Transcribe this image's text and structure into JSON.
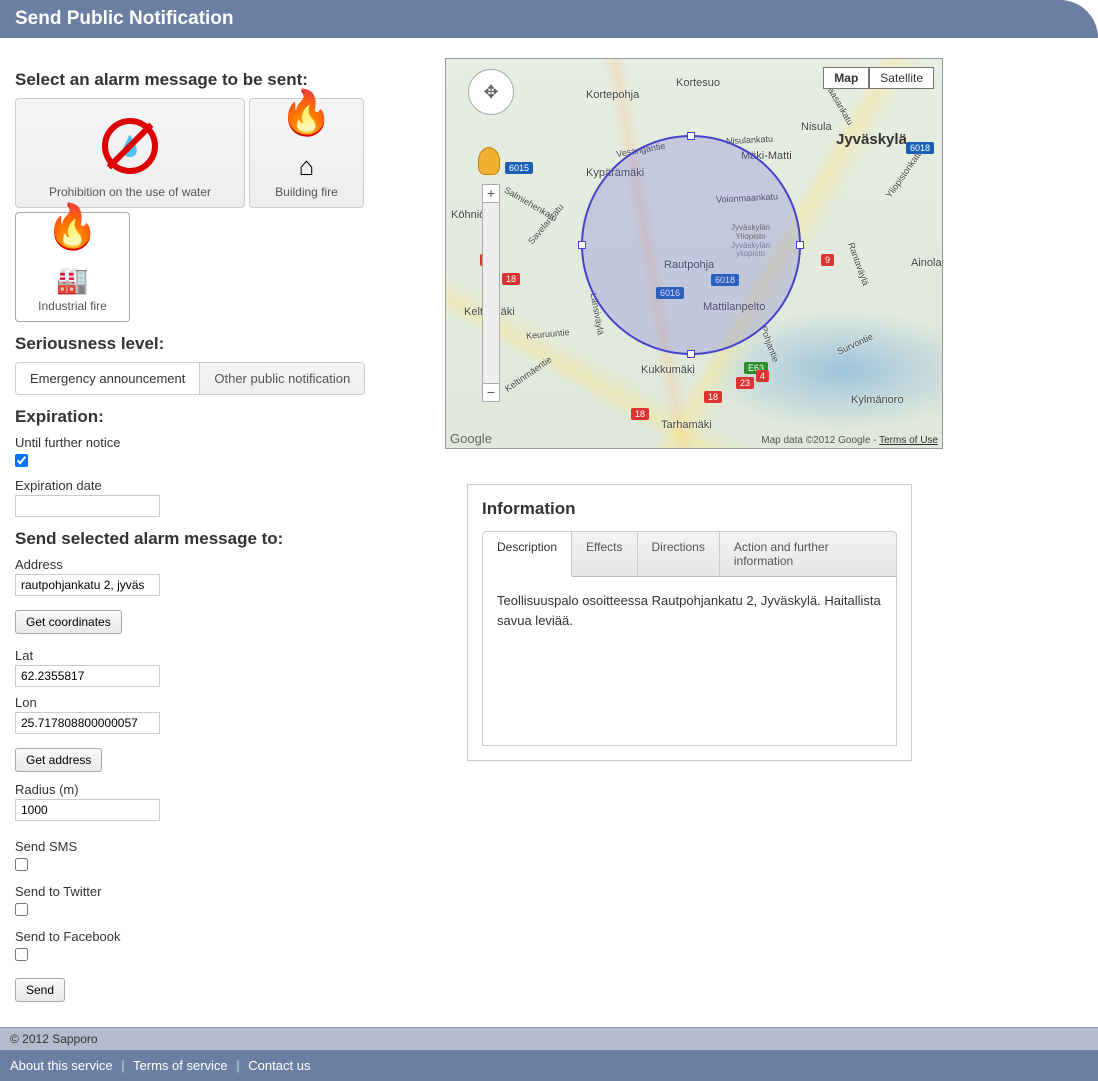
{
  "header": {
    "title": "Send Public Notification"
  },
  "alarm_select": {
    "heading": "Select an alarm message to be sent:",
    "options": [
      {
        "id": "prohibition-water",
        "label": "Prohibition on the use of water",
        "selected": false
      },
      {
        "id": "building-fire",
        "label": "Building fire",
        "selected": false
      },
      {
        "id": "industrial-fire",
        "label": "Industrial fire",
        "selected": true
      }
    ]
  },
  "seriousness": {
    "heading": "Seriousness level:",
    "options": [
      {
        "label": "Emergency announcement",
        "active": true
      },
      {
        "label": "Other public notification",
        "active": false
      }
    ]
  },
  "expiration": {
    "heading": "Expiration:",
    "until_further_label": "Until further notice",
    "until_further_checked": true,
    "date_label": "Expiration date",
    "date_value": ""
  },
  "send_to": {
    "heading": "Send selected alarm message to:",
    "address_label": "Address",
    "address_value": "rautpohjankatu 2, jyväs",
    "get_coords_btn": "Get coordinates",
    "lat_label": "Lat",
    "lat_value": "62.2355817",
    "lon_label": "Lon",
    "lon_value": "25.717808800000057",
    "get_address_btn": "Get address",
    "radius_label": "Radius (m)",
    "radius_value": "1000",
    "sms_label": "Send SMS",
    "sms_checked": false,
    "twitter_label": "Send to Twitter",
    "twitter_checked": false,
    "facebook_label": "Send to Facebook",
    "facebook_checked": false,
    "send_btn": "Send"
  },
  "map": {
    "view_modes": {
      "map": "Map",
      "satellite": "Satellite"
    },
    "city": "Jyväskylä",
    "places": [
      "Kortepohja",
      "Kortesuo",
      "Nisula",
      "Mäki-Matti",
      "Kypärämäki",
      "Köhniö",
      "Keltinmäki",
      "Rautpohja",
      "Mattilanpelto",
      "Kukkumäki",
      "Tarhamäki",
      "Kylmänoro",
      "Ainola",
      "Nisulankatu",
      "Voionmaankatu",
      "Rantaväylä",
      "Vaasankatu",
      "Survontie",
      "Länsiväylä",
      "Keuruuntie",
      "Vesangantie",
      "Savelankatu",
      "Salmiehenkatu",
      "Yliopistonkatu",
      "Pohjantie",
      "Keltinmäentie"
    ],
    "uni_lines": [
      "Jyväskylän",
      "Yliopisto",
      "Jyväskylän",
      "yliopisto"
    ],
    "road_shields": [
      "6015",
      "6018",
      "6018",
      "6016",
      "23",
      "18",
      "18",
      "18",
      "23",
      "E63",
      "9",
      "4"
    ],
    "attribution": "Map data ©2012 Google - ",
    "terms": "Terms of Use",
    "logo": "Google"
  },
  "info": {
    "heading": "Information",
    "tabs": [
      {
        "label": "Description",
        "active": true
      },
      {
        "label": "Effects",
        "active": false
      },
      {
        "label": "Directions",
        "active": false
      },
      {
        "label": "Action and further information",
        "active": false
      }
    ],
    "description_text": "Teollisuuspalo osoitteessa Rautpohjankatu 2, Jyväskylä. Haitallista savua leviää."
  },
  "footer": {
    "copyright": "© 2012 Sapporo",
    "links": [
      "About this service",
      "Terms of service",
      "Contact us"
    ]
  }
}
